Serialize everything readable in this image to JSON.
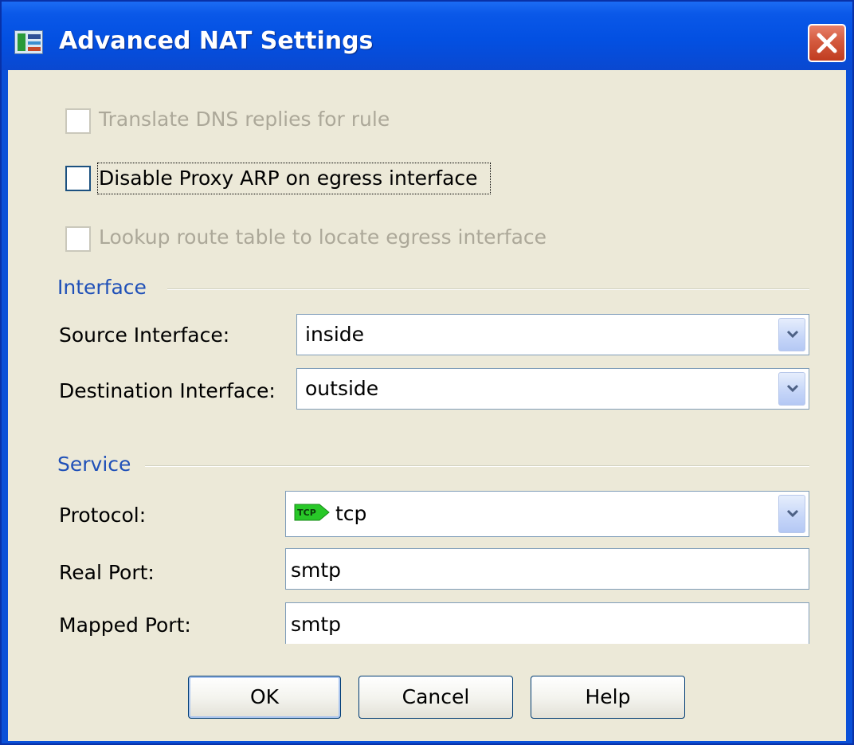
{
  "window": {
    "title": "Advanced NAT Settings",
    "title_icon": "asdm-app-icon",
    "close_icon": "close-x-icon"
  },
  "options": {
    "translate_dns": {
      "label": "Translate DNS replies for rule",
      "checked": false,
      "enabled": false
    },
    "disable_proxy_arp": {
      "label": "Disable Proxy ARP on egress interface",
      "checked": false,
      "enabled": true
    },
    "lookup_route": {
      "label": "Lookup route table to locate egress interface",
      "checked": false,
      "enabled": false
    }
  },
  "interface_group": {
    "title": "Interface",
    "source_label": "Source Interface:",
    "source_value": "inside",
    "destination_label": "Destination Interface:",
    "destination_value": "outside"
  },
  "service_group": {
    "title": "Service",
    "protocol_label": "Protocol:",
    "protocol_value": "tcp",
    "protocol_icon_text": "TCP",
    "real_port_label": "Real Port:",
    "real_port_value": "smtp",
    "mapped_port_label": "Mapped Port:",
    "mapped_port_value": "smtp"
  },
  "buttons": {
    "ok": "OK",
    "cancel": "Cancel",
    "help": "Help"
  },
  "colors": {
    "title_bar": "#0350e2",
    "dialog_face": "#ece9d8",
    "group_title": "#1f50b8",
    "disabled_text": "#aca899",
    "close_button": "#d45a3e",
    "tcp_icon": "#28c828"
  }
}
